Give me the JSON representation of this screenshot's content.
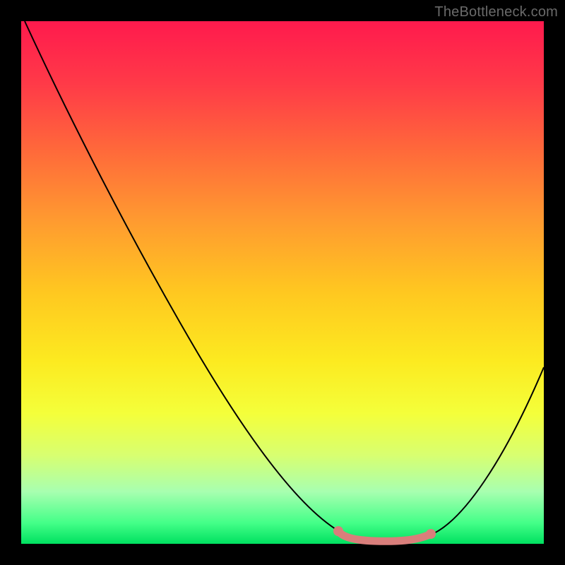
{
  "attribution": "TheBottleneck.com",
  "colors": {
    "frame": "#000000",
    "curve": "#000000",
    "base_segment": "#d97e7b"
  },
  "chart_data": {
    "type": "line",
    "title": "",
    "xlabel": "",
    "ylabel": "",
    "xlim": [
      0,
      100
    ],
    "ylim": [
      0,
      100
    ],
    "series": [
      {
        "name": "bottleneck-curve",
        "x": [
          0,
          5,
          10,
          15,
          20,
          25,
          30,
          35,
          40,
          45,
          50,
          55,
          58,
          62,
          65,
          68,
          72,
          75,
          78,
          82,
          86,
          90,
          94,
          100
        ],
        "values": [
          100,
          92,
          84,
          76,
          68,
          60,
          52,
          44,
          36,
          28,
          20,
          12,
          7,
          3,
          1,
          0,
          0,
          0,
          1,
          4,
          10,
          18,
          28,
          45
        ]
      }
    ],
    "highlight_segment": {
      "name": "sweet-spot",
      "x_start": 61,
      "x_end": 80,
      "y": 0
    }
  }
}
